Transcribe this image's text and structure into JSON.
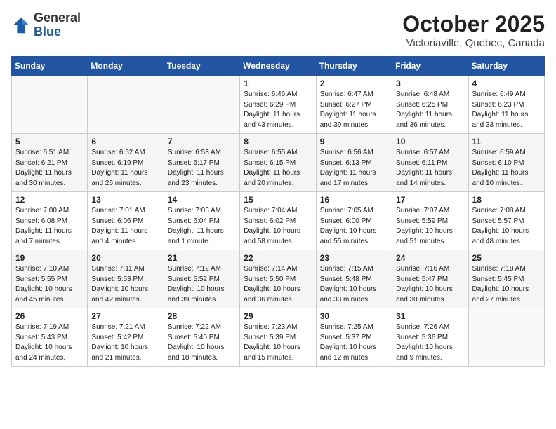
{
  "header": {
    "logo_general": "General",
    "logo_blue": "Blue",
    "month_year": "October 2025",
    "location": "Victoriaville, Quebec, Canada"
  },
  "weekdays": [
    "Sunday",
    "Monday",
    "Tuesday",
    "Wednesday",
    "Thursday",
    "Friday",
    "Saturday"
  ],
  "weeks": [
    [
      {
        "day": "",
        "info": ""
      },
      {
        "day": "",
        "info": ""
      },
      {
        "day": "",
        "info": ""
      },
      {
        "day": "1",
        "info": "Sunrise: 6:46 AM\nSunset: 6:29 PM\nDaylight: 11 hours\nand 43 minutes."
      },
      {
        "day": "2",
        "info": "Sunrise: 6:47 AM\nSunset: 6:27 PM\nDaylight: 11 hours\nand 39 minutes."
      },
      {
        "day": "3",
        "info": "Sunrise: 6:48 AM\nSunset: 6:25 PM\nDaylight: 11 hours\nand 36 minutes."
      },
      {
        "day": "4",
        "info": "Sunrise: 6:49 AM\nSunset: 6:23 PM\nDaylight: 11 hours\nand 33 minutes."
      }
    ],
    [
      {
        "day": "5",
        "info": "Sunrise: 6:51 AM\nSunset: 6:21 PM\nDaylight: 11 hours\nand 30 minutes."
      },
      {
        "day": "6",
        "info": "Sunrise: 6:52 AM\nSunset: 6:19 PM\nDaylight: 11 hours\nand 26 minutes."
      },
      {
        "day": "7",
        "info": "Sunrise: 6:53 AM\nSunset: 6:17 PM\nDaylight: 11 hours\nand 23 minutes."
      },
      {
        "day": "8",
        "info": "Sunrise: 6:55 AM\nSunset: 6:15 PM\nDaylight: 11 hours\nand 20 minutes."
      },
      {
        "day": "9",
        "info": "Sunrise: 6:56 AM\nSunset: 6:13 PM\nDaylight: 11 hours\nand 17 minutes."
      },
      {
        "day": "10",
        "info": "Sunrise: 6:57 AM\nSunset: 6:11 PM\nDaylight: 11 hours\nand 14 minutes."
      },
      {
        "day": "11",
        "info": "Sunrise: 6:59 AM\nSunset: 6:10 PM\nDaylight: 11 hours\nand 10 minutes."
      }
    ],
    [
      {
        "day": "12",
        "info": "Sunrise: 7:00 AM\nSunset: 6:08 PM\nDaylight: 11 hours\nand 7 minutes."
      },
      {
        "day": "13",
        "info": "Sunrise: 7:01 AM\nSunset: 6:06 PM\nDaylight: 11 hours\nand 4 minutes."
      },
      {
        "day": "14",
        "info": "Sunrise: 7:03 AM\nSunset: 6:04 PM\nDaylight: 11 hours\nand 1 minute."
      },
      {
        "day": "15",
        "info": "Sunrise: 7:04 AM\nSunset: 6:02 PM\nDaylight: 10 hours\nand 58 minutes."
      },
      {
        "day": "16",
        "info": "Sunrise: 7:05 AM\nSunset: 6:00 PM\nDaylight: 10 hours\nand 55 minutes."
      },
      {
        "day": "17",
        "info": "Sunrise: 7:07 AM\nSunset: 5:59 PM\nDaylight: 10 hours\nand 51 minutes."
      },
      {
        "day": "18",
        "info": "Sunrise: 7:08 AM\nSunset: 5:57 PM\nDaylight: 10 hours\nand 48 minutes."
      }
    ],
    [
      {
        "day": "19",
        "info": "Sunrise: 7:10 AM\nSunset: 5:55 PM\nDaylight: 10 hours\nand 45 minutes."
      },
      {
        "day": "20",
        "info": "Sunrise: 7:11 AM\nSunset: 5:53 PM\nDaylight: 10 hours\nand 42 minutes."
      },
      {
        "day": "21",
        "info": "Sunrise: 7:12 AM\nSunset: 5:52 PM\nDaylight: 10 hours\nand 39 minutes."
      },
      {
        "day": "22",
        "info": "Sunrise: 7:14 AM\nSunset: 5:50 PM\nDaylight: 10 hours\nand 36 minutes."
      },
      {
        "day": "23",
        "info": "Sunrise: 7:15 AM\nSunset: 5:48 PM\nDaylight: 10 hours\nand 33 minutes."
      },
      {
        "day": "24",
        "info": "Sunrise: 7:16 AM\nSunset: 5:47 PM\nDaylight: 10 hours\nand 30 minutes."
      },
      {
        "day": "25",
        "info": "Sunrise: 7:18 AM\nSunset: 5:45 PM\nDaylight: 10 hours\nand 27 minutes."
      }
    ],
    [
      {
        "day": "26",
        "info": "Sunrise: 7:19 AM\nSunset: 5:43 PM\nDaylight: 10 hours\nand 24 minutes."
      },
      {
        "day": "27",
        "info": "Sunrise: 7:21 AM\nSunset: 5:42 PM\nDaylight: 10 hours\nand 21 minutes."
      },
      {
        "day": "28",
        "info": "Sunrise: 7:22 AM\nSunset: 5:40 PM\nDaylight: 10 hours\nand 18 minutes."
      },
      {
        "day": "29",
        "info": "Sunrise: 7:23 AM\nSunset: 5:39 PM\nDaylight: 10 hours\nand 15 minutes."
      },
      {
        "day": "30",
        "info": "Sunrise: 7:25 AM\nSunset: 5:37 PM\nDaylight: 10 hours\nand 12 minutes."
      },
      {
        "day": "31",
        "info": "Sunrise: 7:26 AM\nSunset: 5:36 PM\nDaylight: 10 hours\nand 9 minutes."
      },
      {
        "day": "",
        "info": ""
      }
    ]
  ]
}
